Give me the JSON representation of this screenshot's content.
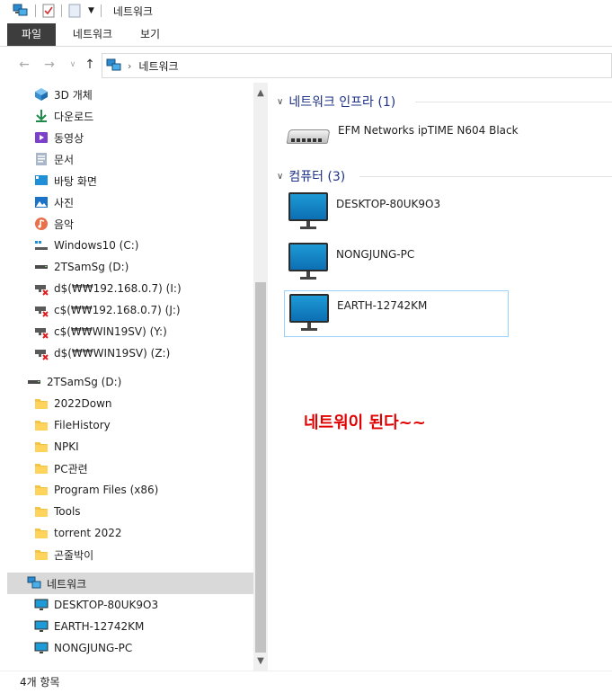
{
  "window": {
    "title": "네트워크"
  },
  "ribbon": {
    "tabs": [
      "파일",
      "네트워크",
      "보기"
    ]
  },
  "address": {
    "crumb": "네트워크"
  },
  "navpane": {
    "quick": [
      {
        "label": "3D 개체",
        "icon": "3d-objects-icon"
      },
      {
        "label": "다운로드",
        "icon": "download-icon"
      },
      {
        "label": "동영상",
        "icon": "video-icon"
      },
      {
        "label": "문서",
        "icon": "document-icon"
      },
      {
        "label": "바탕 화면",
        "icon": "desktop-icon"
      },
      {
        "label": "사진",
        "icon": "pictures-icon"
      },
      {
        "label": "음악",
        "icon": "music-icon"
      },
      {
        "label": "Windows10 (C:)",
        "icon": "windows-drive-icon"
      },
      {
        "label": "2TSamSg (D:)",
        "icon": "drive-icon"
      },
      {
        "label": "d$(₩₩192.168.0.7) (I:)",
        "icon": "disconnected-network-drive-icon"
      },
      {
        "label": "c$(₩₩192.168.0.7) (J:)",
        "icon": "disconnected-network-drive-icon"
      },
      {
        "label": "c$(₩₩WIN19SV) (Y:)",
        "icon": "disconnected-network-drive-icon"
      },
      {
        "label": "d$(₩₩WIN19SV) (Z:)",
        "icon": "disconnected-network-drive-icon"
      }
    ],
    "drive": {
      "label": "2TSamSg (D:)"
    },
    "folders": [
      "2022Down",
      "FileHistory",
      "NPKI",
      "PC관련",
      "Program Files (x86)",
      "Tools",
      "torrent 2022",
      "곤줄박이"
    ],
    "network": {
      "label": "네트워크"
    },
    "computers": [
      "DESKTOP-80UK9O3",
      "EARTH-12742KM",
      "NONGJUNG-PC"
    ]
  },
  "content": {
    "groups": [
      {
        "title": "네트워크 인프라 (1)",
        "items": [
          "EFM Networks ipTIME N604 Black"
        ]
      },
      {
        "title": "컴퓨터 (3)",
        "items": [
          "DESKTOP-80UK9O3",
          "NONGJUNG-PC",
          "EARTH-12742KM"
        ]
      }
    ],
    "annotation": "네트워이 된다~~"
  },
  "status": {
    "count": "4개 항목"
  },
  "colors": {
    "accent": "#1e3287",
    "annotation": "#e00000",
    "selected_border": "#99d1ff"
  }
}
